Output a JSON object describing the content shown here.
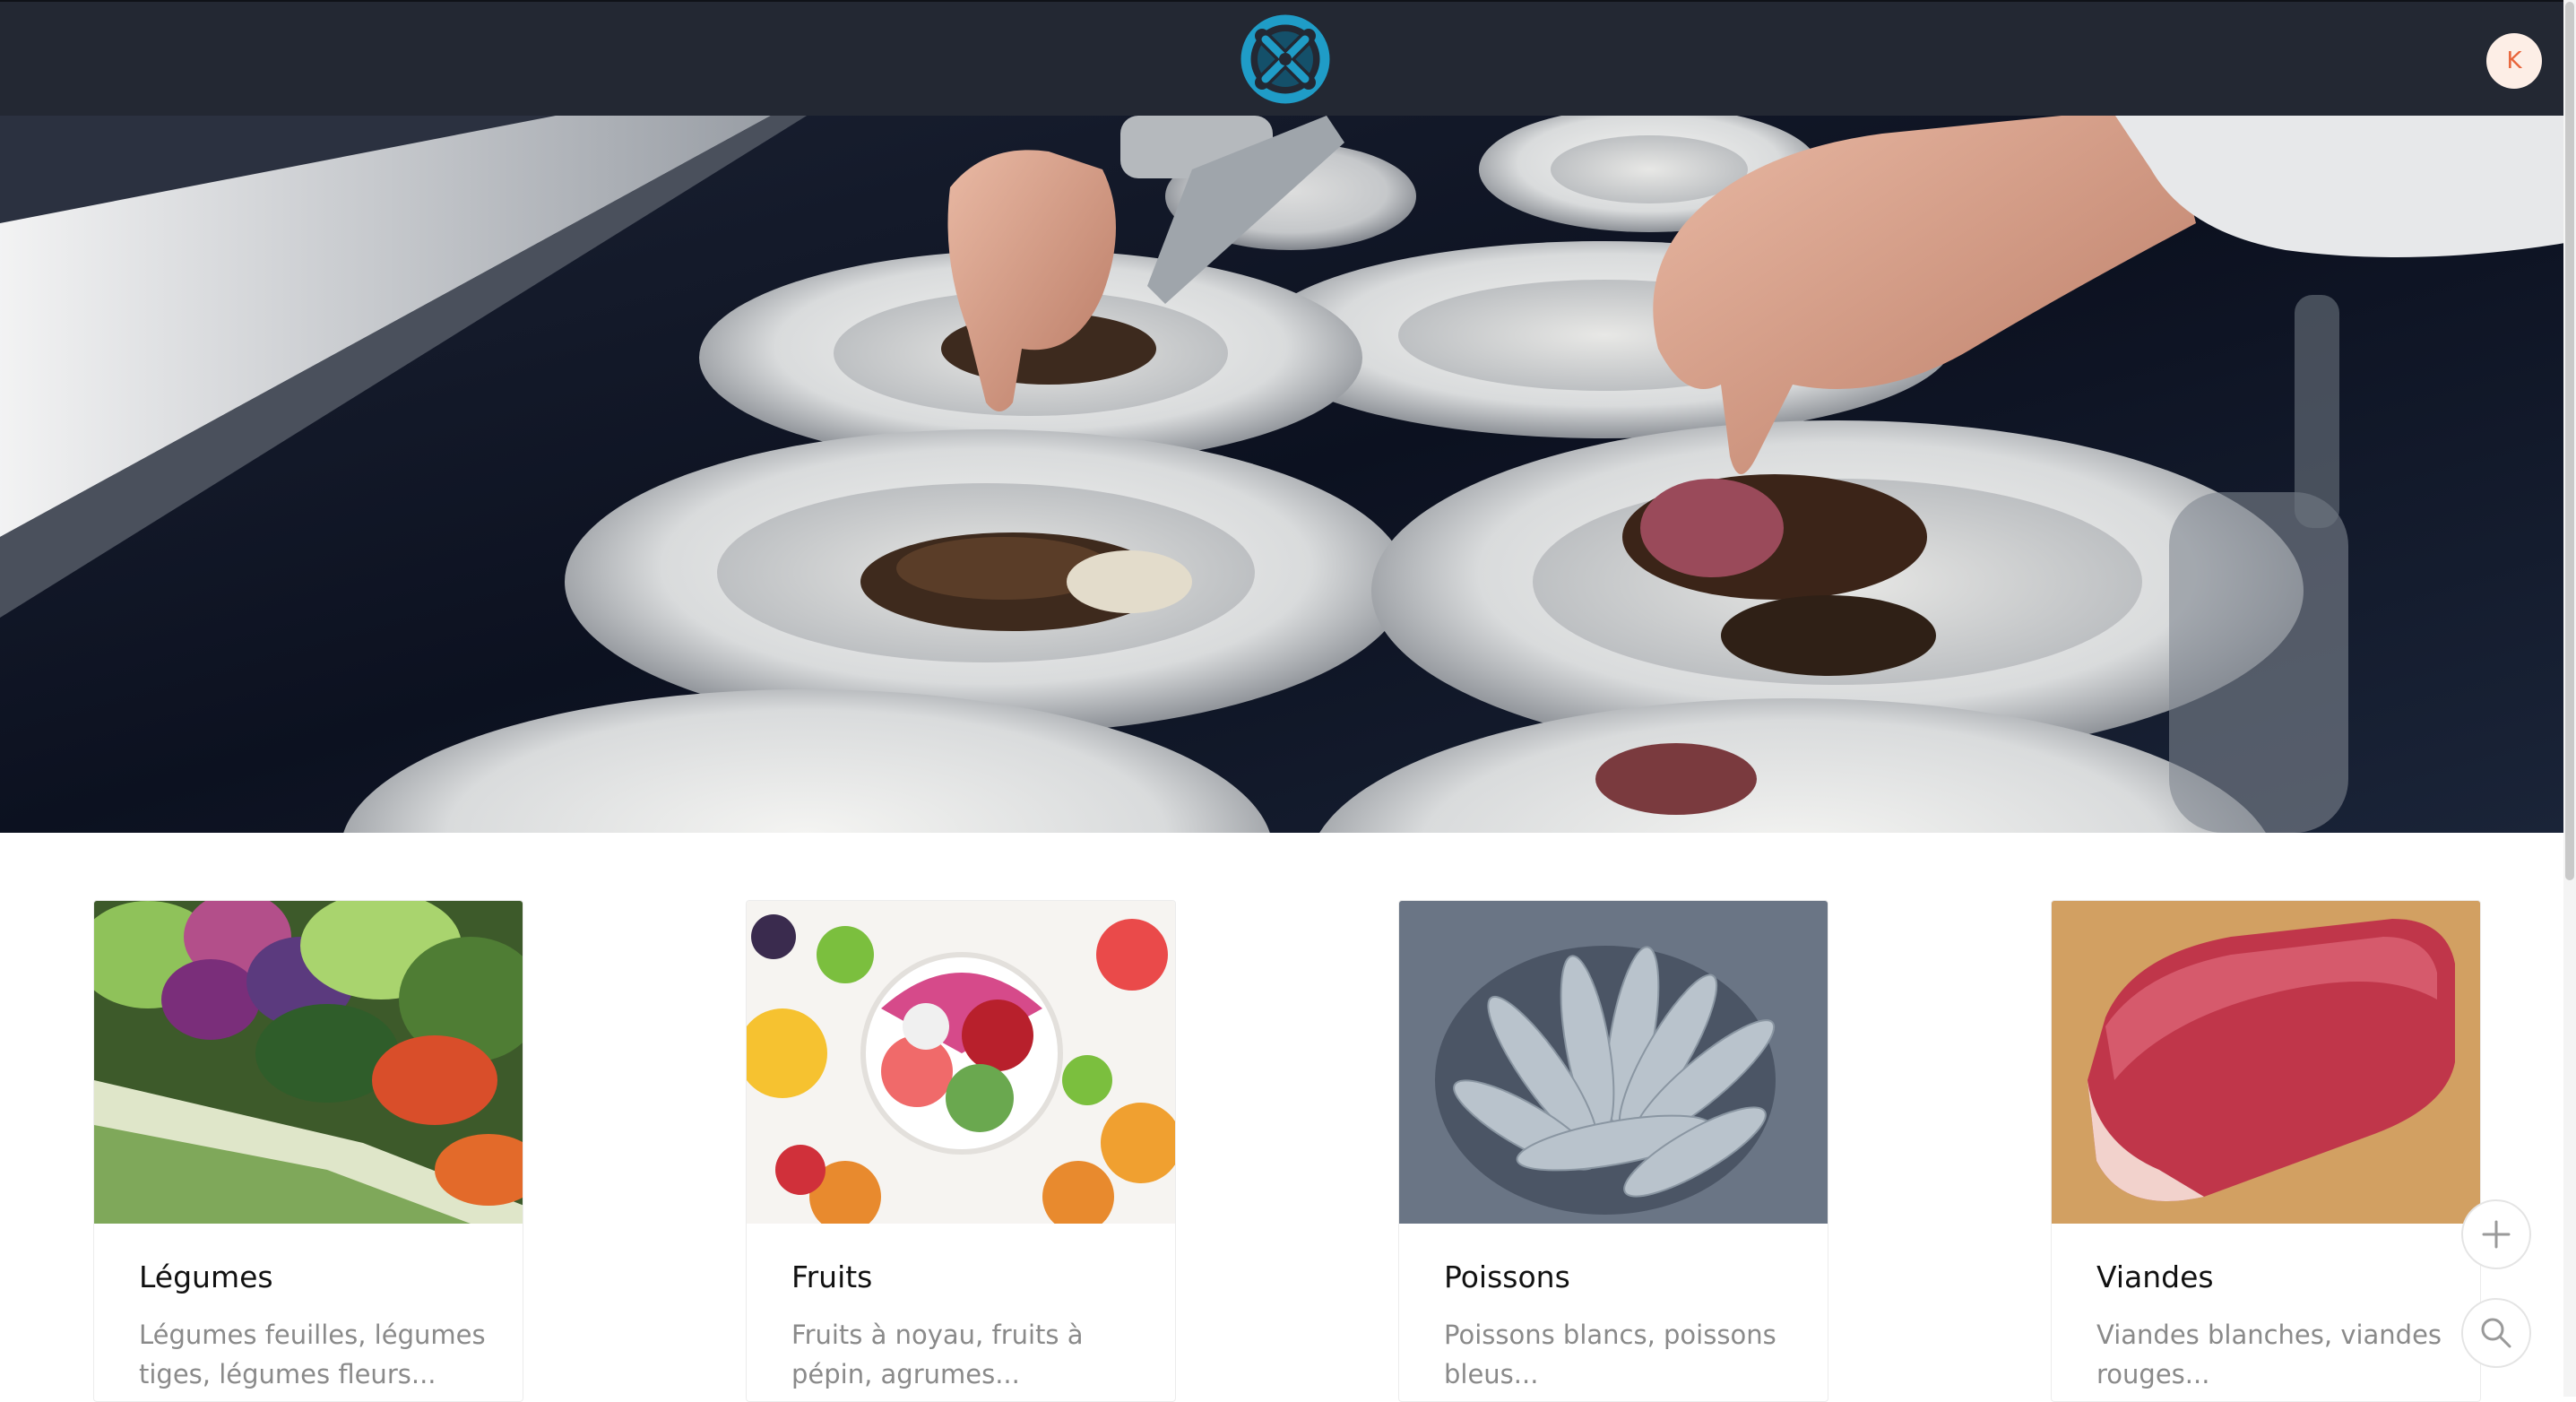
{
  "header": {
    "logo": "app-logo",
    "user_initial": "K"
  },
  "hero": {
    "slides_count": 3,
    "active_slide": 3
  },
  "categories": [
    {
      "title": "Légumes",
      "description": "Légumes feuilles, légumes tiges, légumes fleurs..."
    },
    {
      "title": "Fruits",
      "description": "Fruits à noyau, fruits à pépin, agrumes..."
    },
    {
      "title": "Poissons",
      "description": "Poissons blancs, poissons bleus..."
    },
    {
      "title": "Viandes",
      "description": "Viandes blanches, viandes rouges..."
    }
  ],
  "actions": {
    "add_icon": "plus-icon",
    "search_icon": "search-icon"
  },
  "colors": {
    "header_bg": "#232833",
    "logo_blue": "#1f9cc7",
    "avatar_bg": "#fdeee6",
    "avatar_text": "#e8643a"
  }
}
